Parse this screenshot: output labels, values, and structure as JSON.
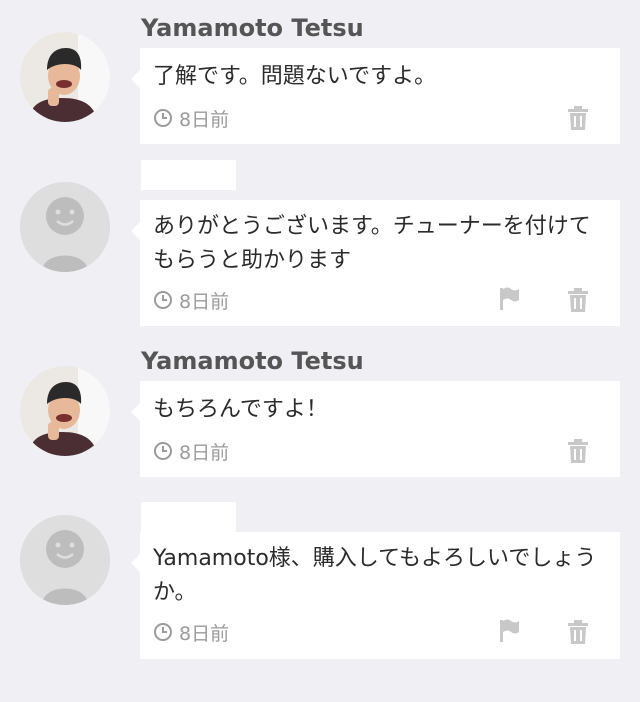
{
  "comments": [
    {
      "user": "Yamamoto Tetsu",
      "avatar": "user-photo",
      "text": "了解です。問題ないですよ。",
      "time": "8日前",
      "actions": [
        "trash-icon"
      ]
    },
    {
      "user": "",
      "avatar": "default-avatar",
      "text": "ありがとうございます。チューナーを付けてもらうと助かります",
      "time": "8日前",
      "actions": [
        "flag-icon",
        "trash-icon"
      ]
    },
    {
      "user": "Yamamoto Tetsu",
      "avatar": "user-photo",
      "text": "もちろんですよ！",
      "time": "8日前",
      "actions": [
        "trash-icon"
      ]
    },
    {
      "user": "",
      "avatar": "default-avatar",
      "text": "Yamamoto様、購入してもよろしいでしょうか。",
      "time": "8日前",
      "actions": [
        "flag-icon",
        "trash-icon"
      ]
    }
  ],
  "colors": {
    "background": "#efeff4",
    "bubble": "#ffffff",
    "meta_gray": "#9b9b9b",
    "icon_gray": "#c8c8c8"
  }
}
